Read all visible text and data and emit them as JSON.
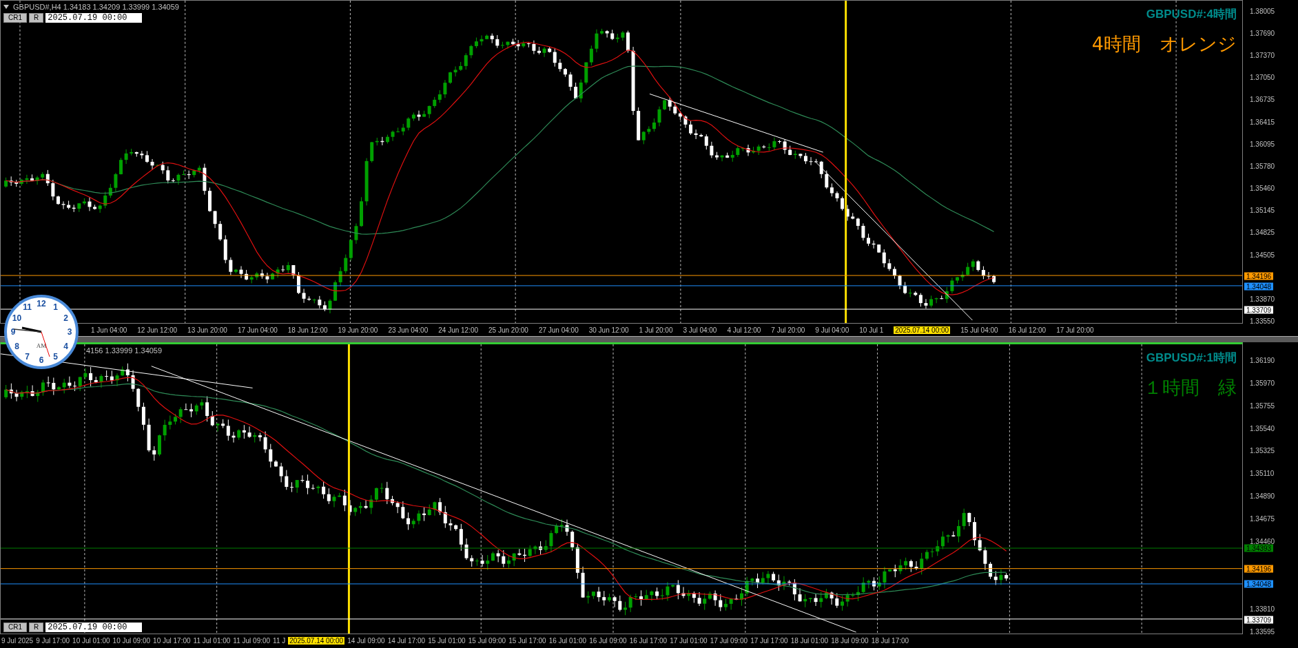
{
  "charts": [
    {
      "kind": "h4",
      "active": false,
      "header": "GBPUSD#,H4  1.34183 1.34209 1.33999 1.34059",
      "symbol_label": "GBPUSD#:4時間",
      "note": "4時間　オレンジ",
      "color": "#ff9900",
      "controls": {
        "buttons": [
          "CR1",
          "R"
        ],
        "date_value": "2025.07.19 00:00"
      },
      "price_ticks": [
        "1.38005",
        "1.37690",
        "1.37370",
        "1.37050",
        "1.36735",
        "1.36415",
        "1.36095",
        "1.35780",
        "1.35460",
        "1.35145",
        "1.34825",
        "1.34505",
        "1.33870",
        "1.33550"
      ],
      "price_lines": [
        {
          "label": "1.34196",
          "color": "#ff9900"
        },
        {
          "label": "1.34048",
          "color": "#1e90ff"
        },
        {
          "label": "1.33709",
          "color": "#ffffff"
        }
      ],
      "time_labels": [
        {
          "text": "1 Jun 04:00",
          "kind": "normal"
        },
        {
          "text": "12 Jun 12:00",
          "kind": "normal"
        },
        {
          "text": "13 Jun 20:00",
          "kind": "normal"
        },
        {
          "text": "17 Jun 04:00",
          "kind": "normal"
        },
        {
          "text": "18 Jun 12:00",
          "kind": "normal"
        },
        {
          "text": "19 Jun 20:00",
          "kind": "normal"
        },
        {
          "text": "23 Jun 04:00",
          "kind": "normal"
        },
        {
          "text": "24 Jun 12:00",
          "kind": "normal"
        },
        {
          "text": "25 Jun 20:00",
          "kind": "normal"
        },
        {
          "text": "27 Jun 04:00",
          "kind": "normal"
        },
        {
          "text": "30 Jun 12:00",
          "kind": "normal"
        },
        {
          "text": "1 Jul 20:00",
          "kind": "normal"
        },
        {
          "text": "3 Jul 04:00",
          "kind": "normal"
        },
        {
          "text": "4 Jul 12:00",
          "kind": "normal"
        },
        {
          "text": "7 Jul 20:00",
          "kind": "normal"
        },
        {
          "text": "9 Jul 04:00",
          "kind": "normal"
        },
        {
          "text": "10 Jul 1",
          "kind": "normal"
        },
        {
          "text": "2025.07.14 00:00",
          "kind": "highlight"
        },
        {
          "text": "15 Jul 04:00",
          "kind": "normal"
        },
        {
          "text": "16 Jul 12:00",
          "kind": "normal"
        },
        {
          "text": "17 Jul 20:00",
          "kind": "normal"
        }
      ]
    },
    {
      "kind": "h1",
      "active": true,
      "header": "4156 1.33999 1.34059",
      "symbol_label": "GBPUSD#:1時間",
      "note": "１時間　緑",
      "color": "#008000",
      "controls": {
        "buttons": [
          "CR1",
          "R"
        ],
        "date_value": "2025.07.19 00:00"
      },
      "price_ticks": [
        "1.36190",
        "1.35970",
        "1.35755",
        "1.35540",
        "1.35325",
        "1.35110",
        "1.34890",
        "1.34675",
        "1.34460",
        "1.33810",
        "1.33595"
      ],
      "price_lines": [
        {
          "label": "1.34393",
          "color": "#008000"
        },
        {
          "label": "1.34196",
          "color": "#ff9900"
        },
        {
          "label": "1.34048",
          "color": "#1e90ff"
        },
        {
          "label": "1.33709",
          "color": "#ffffff"
        }
      ],
      "time_labels": [
        {
          "text": "9 Jul 2025",
          "kind": "normal"
        },
        {
          "text": "9 Jul 17:00",
          "kind": "normal"
        },
        {
          "text": "10 Jul 01:00",
          "kind": "normal"
        },
        {
          "text": "10 Jul 09:00",
          "kind": "normal"
        },
        {
          "text": "10 Jul 17:00",
          "kind": "normal"
        },
        {
          "text": "11 Jul 01:00",
          "kind": "normal"
        },
        {
          "text": "11 Jul 09:00",
          "kind": "normal"
        },
        {
          "text": "11 J",
          "kind": "normal"
        },
        {
          "text": "2025.07.14 00:00",
          "kind": "highlight"
        },
        {
          "text": "14 Jul 09:00",
          "kind": "normal"
        },
        {
          "text": "14 Jul 17:00",
          "kind": "normal"
        },
        {
          "text": "15 Jul 01:00",
          "kind": "normal"
        },
        {
          "text": "15 Jul 09:00",
          "kind": "normal"
        },
        {
          "text": "15 Jul 17:00",
          "kind": "normal"
        },
        {
          "text": "16 Jul 01:00",
          "kind": "normal"
        },
        {
          "text": "16 Jul 09:00",
          "kind": "normal"
        },
        {
          "text": "16 Jul 17:00",
          "kind": "normal"
        },
        {
          "text": "17 Jul 01:00",
          "kind": "normal"
        },
        {
          "text": "17 Jul 09:00",
          "kind": "normal"
        },
        {
          "text": "17 Jul 17:00",
          "kind": "normal"
        },
        {
          "text": "18 Jul 01:00",
          "kind": "normal"
        },
        {
          "text": "18 Jul 09:00",
          "kind": "normal"
        },
        {
          "text": "18 Jul 17:00",
          "kind": "normal"
        }
      ]
    }
  ],
  "clock": {
    "numerals": [
      "12",
      "11",
      "1",
      "10",
      "2",
      "9",
      "3",
      "8",
      "4",
      "7",
      "5",
      "6"
    ],
    "period": "AM"
  }
}
